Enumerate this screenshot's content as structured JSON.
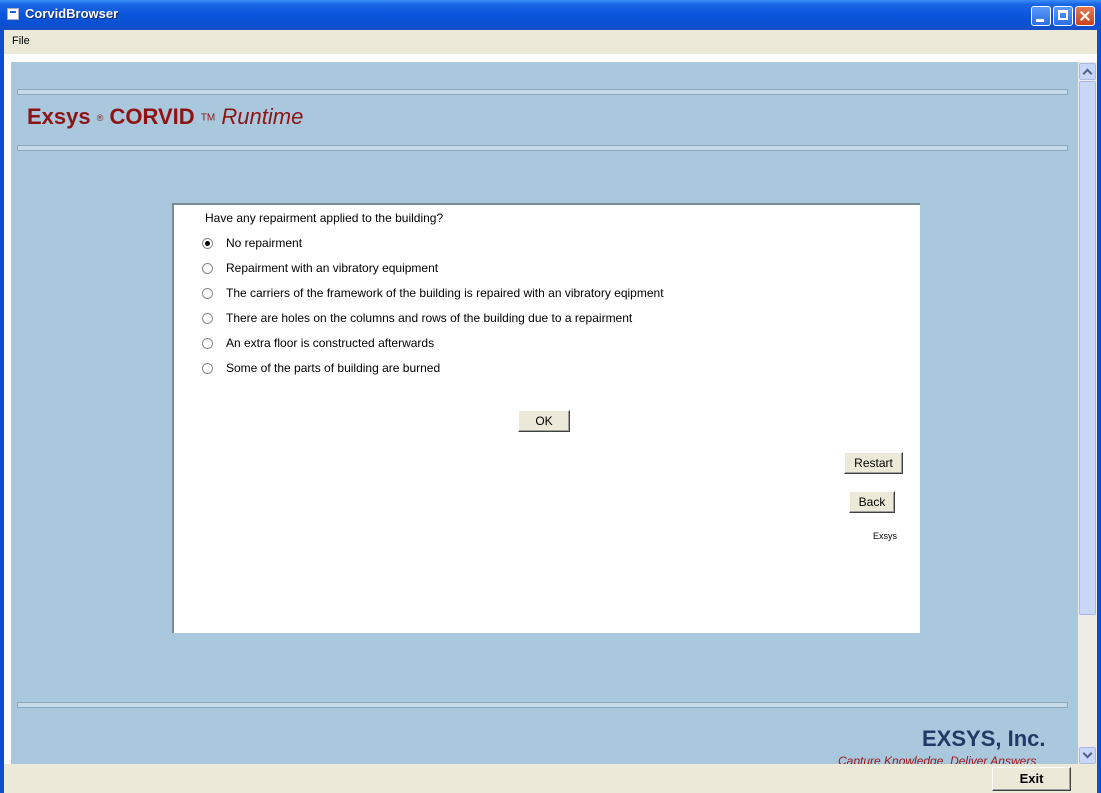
{
  "window": {
    "title": "CorvidBrowser"
  },
  "menu": {
    "file": "File"
  },
  "brand": {
    "name": "Exsys",
    "registered": "®",
    "product": "CORVID",
    "trademark": "TM",
    "edition": "Runtime"
  },
  "question": {
    "text": "Have any repairment applied to the building?",
    "selected_index": 0,
    "options": [
      {
        "label": "No repairment"
      },
      {
        "label": "Repairment with an vibratory equipment"
      },
      {
        "label": "The carriers of the framework of the building is repaired with an vibratory eqipment"
      },
      {
        "label": "There are holes on the columns and rows of the building due to a repairment"
      },
      {
        "label": "An extra floor is constructed afterwards"
      },
      {
        "label": "Some of the parts of building are burned"
      }
    ]
  },
  "buttons": {
    "ok": "OK",
    "restart": "Restart",
    "back": "Back",
    "exit": "Exit"
  },
  "panel": {
    "footer_text": "Exsys"
  },
  "company": {
    "name": "EXSYS, Inc.",
    "slogan": "Capture Knowledge, Deliver Answers"
  },
  "colors": {
    "background": "#a9c8dd",
    "brand": "#8e1414",
    "company": "#1f3a66"
  }
}
